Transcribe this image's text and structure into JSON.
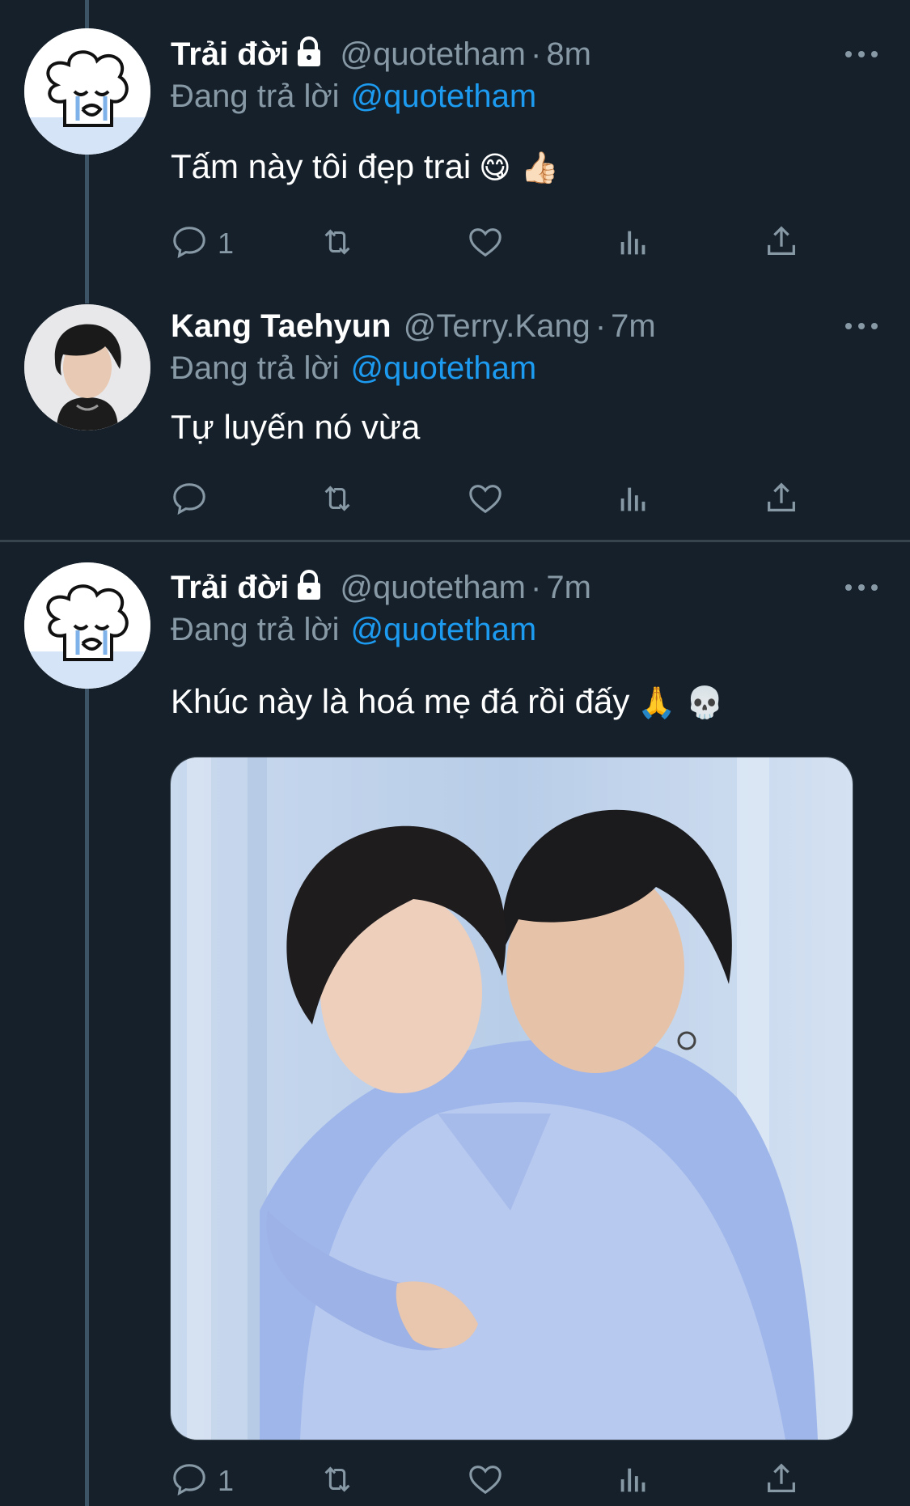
{
  "tweets": [
    {
      "name": "Trải đời",
      "handle": "@quotetham",
      "dot": "·",
      "time": "8m",
      "replying_label": "Đang trả lời",
      "replying_to": "@quotetham",
      "text": "Tấm này tôi đẹp trai",
      "emojis": "😋 👍🏻",
      "reply_count": "1",
      "protected": true
    },
    {
      "name": "Kang Taehyun",
      "handle": "@Terry.Kang",
      "dot": "·",
      "time": "7m",
      "replying_label": "Đang trả lời",
      "replying_to": "@quotetham",
      "text": "Tự luyến nó vừa",
      "emojis": "",
      "reply_count": "",
      "protected": false
    },
    {
      "name": "Trải đời",
      "handle": "@quotetham",
      "dot": "·",
      "time": "7m",
      "replying_label": "Đang trả lời",
      "replying_to": "@quotetham",
      "text": "Khúc này là hoá mẹ đá rồi đấy",
      "emojis": "🙏 💀",
      "reply_count": "1",
      "protected": true
    }
  ],
  "icons": {
    "reply": "reply-icon",
    "retweet": "retweet-icon",
    "like": "heart-icon",
    "views": "views-icon",
    "share": "share-icon",
    "more": "more-icon",
    "lock": "lock-icon"
  },
  "colors": {
    "background": "#15202b",
    "secondary_text": "#8899a6",
    "mention": "#1d9bf0",
    "divider": "#38444d"
  }
}
